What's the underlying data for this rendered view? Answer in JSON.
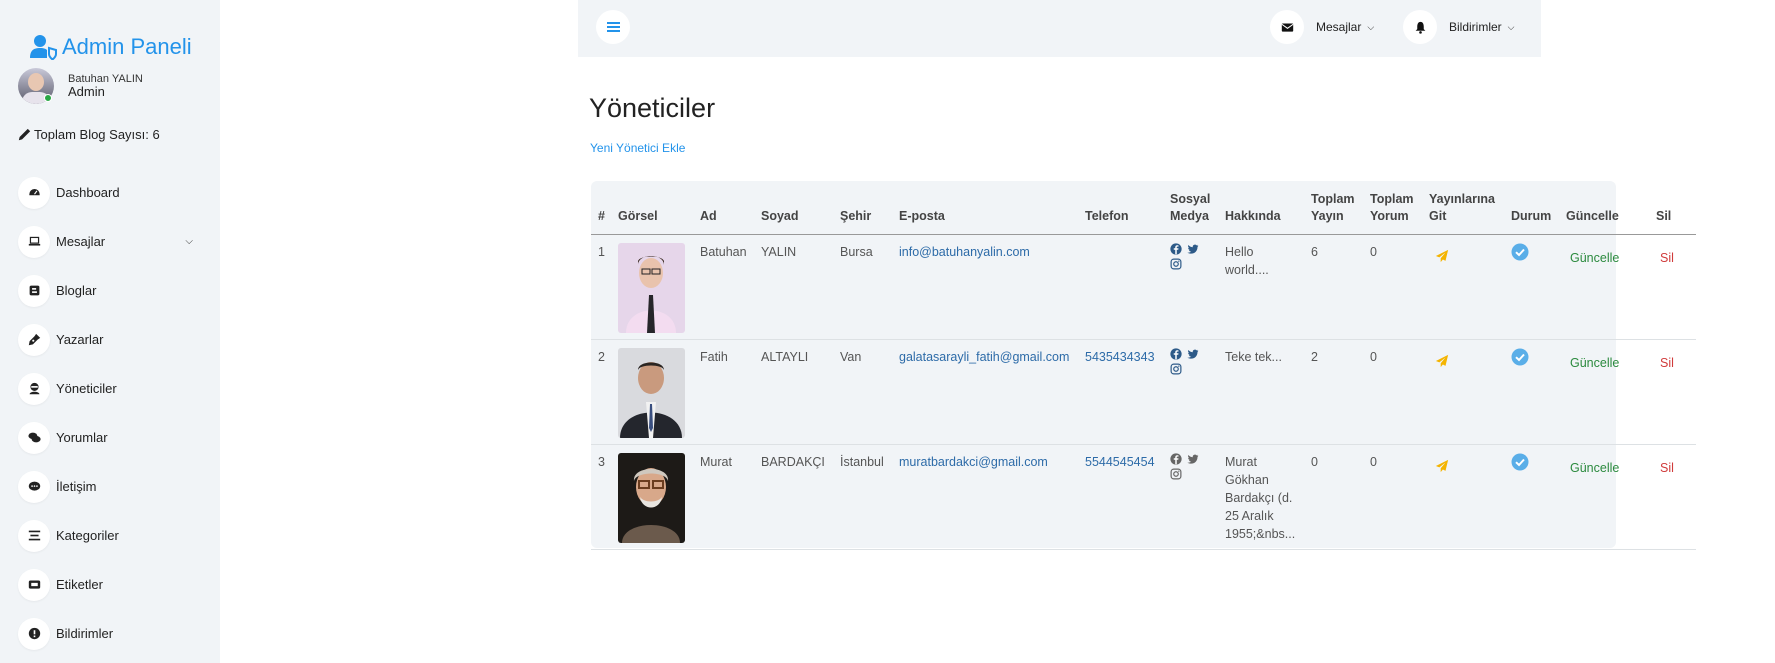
{
  "sidebar": {
    "brand": "Admin Paneli",
    "user_name": "Batuhan YALIN",
    "user_role": "Admin",
    "blog_count": "Toplam Blog Sayısı: 6",
    "items": [
      {
        "label": "Dashboard",
        "icon": "tachometer-icon"
      },
      {
        "label": "Mesajlar",
        "icon": "laptop-icon"
      },
      {
        "label": "Bloglar",
        "icon": "blogger-icon"
      },
      {
        "label": "Yazarlar",
        "icon": "pen-nib-icon"
      },
      {
        "label": "Yöneticiler",
        "icon": "user-ninja-icon"
      },
      {
        "label": "Yorumlar",
        "icon": "comments-icon"
      },
      {
        "label": "İletişim",
        "icon": "comment-dots-icon"
      },
      {
        "label": "Kategoriler",
        "icon": "align-center-icon"
      },
      {
        "label": "Etiketler",
        "icon": "tag-rect-icon"
      },
      {
        "label": "Bildirimler",
        "icon": "info-circle-icon"
      }
    ]
  },
  "topbar": {
    "messages_label": "Mesajlar",
    "notifications_label": "Bildirimler"
  },
  "main": {
    "title": "Yöneticiler",
    "add_link": "Yeni Yönetici Ekle",
    "columns": {
      "num": "#",
      "photo": "Görsel",
      "first": "Ad",
      "last": "Soyad",
      "city": "Şehir",
      "email": "E-posta",
      "phone": "Telefon",
      "social_1": "Sosyal",
      "social_2": "Medya",
      "about": "Hakkında",
      "posts_1": "Toplam",
      "posts_2": "Yayın",
      "comments_1": "Toplam",
      "comments_2": "Yorum",
      "go_1": "Yayınlarına",
      "go_2": "Git",
      "status": "Durum",
      "update": "Güncelle",
      "delete": "Sil"
    },
    "rows": [
      {
        "num": "1",
        "first": "Batuhan",
        "last": "YALIN",
        "city": "Bursa",
        "email": "info@batuhanyalin.com",
        "phone": "",
        "about": "Hello world....",
        "posts": "6",
        "comments": "0",
        "update": "Güncelle",
        "delete": "Sil"
      },
      {
        "num": "2",
        "first": "Fatih",
        "last": "ALTAYLI",
        "city": "Van",
        "email": "galatasarayli_fatih@gmail.com",
        "phone": "5435434343",
        "about": "Teke tek...",
        "posts": "2",
        "comments": "0",
        "update": "Güncelle",
        "delete": "Sil"
      },
      {
        "num": "3",
        "first": "Murat",
        "last": "BARDAKÇI",
        "city": "İstanbul",
        "email": "muratbardakci@gmail.com",
        "phone": "5544545454",
        "about": "Murat Gökhan Bardakçı (d. 25 Aralık 1955;&nbs...",
        "posts": "0",
        "comments": "0",
        "update": "Güncelle",
        "delete": "Sil"
      }
    ]
  },
  "colors": {
    "accent": "#2393ea",
    "panel": "#f1f4f7",
    "update": "#2b8a3e",
    "delete": "#d03b3b",
    "go": "#f4b400",
    "status": "#5aaee8"
  }
}
